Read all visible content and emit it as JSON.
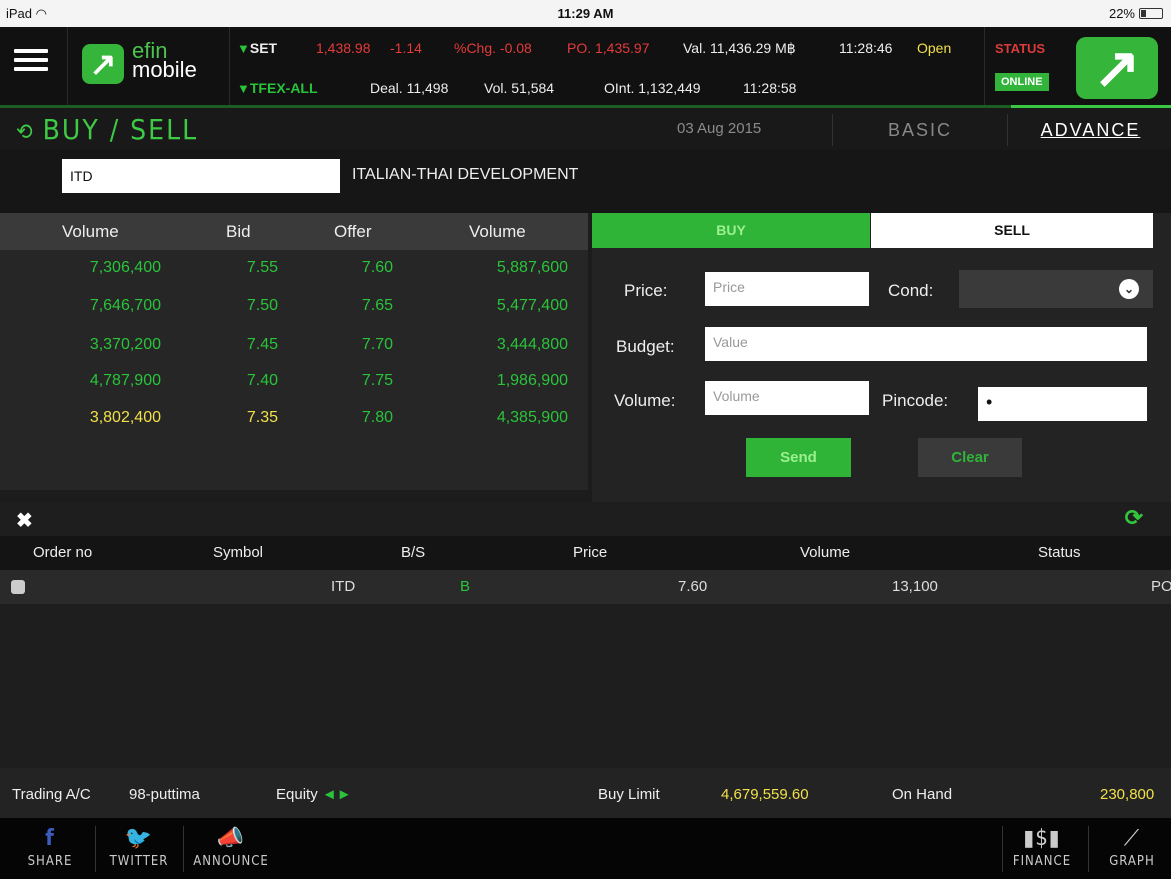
{
  "status_bar": {
    "device": "iPad",
    "time": "11:29 AM",
    "battery": "22%"
  },
  "header": {
    "logo_text_top": "efin",
    "logo_text_bottom": "mobile",
    "set": {
      "label": "SET",
      "index": "1,438.98",
      "change": "-1.14",
      "pct_change": "%Chg. -0.08",
      "po": "PO. 1,435.97",
      "value": "Val. 11,436.29 M฿",
      "time": "11:28:46",
      "state": "Open"
    },
    "tfex": {
      "label": "TFEX-ALL",
      "deal": "Deal. 11,498",
      "volume": "Vol. 51,584",
      "oint": "OInt. 1,132,449",
      "time": "11:28:58"
    },
    "status_label": "STATUS",
    "status_value": "ONLINE"
  },
  "subheader": {
    "title": "BUY / SELL",
    "date": "03 Aug 2015",
    "tab_basic": "BASIC",
    "tab_advance": "ADVANCE"
  },
  "symbol": {
    "code": "ITD",
    "name": "ITALIAN-THAI DEVELOPMENT"
  },
  "bid_offer": {
    "headers": [
      "Volume",
      "Bid",
      "Offer",
      "Volume"
    ],
    "rows": [
      {
        "bid_vol": "7,306,400",
        "bid": "7.55",
        "offer": "7.60",
        "offer_vol": "5,887,600"
      },
      {
        "bid_vol": "7,646,700",
        "bid": "7.50",
        "offer": "7.65",
        "offer_vol": "5,477,400"
      },
      {
        "bid_vol": "3,370,200",
        "bid": "7.45",
        "offer": "7.70",
        "offer_vol": "3,444,800"
      },
      {
        "bid_vol": "4,787,900",
        "bid": "7.40",
        "offer": "7.75",
        "offer_vol": "1,986,900"
      },
      {
        "bid_vol": "3,802,400",
        "bid": "7.35",
        "offer": "7.80",
        "offer_vol": "4,385,900"
      }
    ]
  },
  "order_form": {
    "tab_buy": "BUY",
    "tab_sell": "SELL",
    "price_label": "Price:",
    "price_placeholder": "Price",
    "cond_label": "Cond:",
    "budget_label": "Budget:",
    "budget_placeholder": "Value",
    "volume_label": "Volume:",
    "volume_placeholder": "Volume",
    "pincode_label": "Pincode:",
    "pincode_value": "•",
    "send": "Send",
    "clear": "Clear"
  },
  "orders": {
    "headers": [
      "Order no",
      "Symbol",
      "B/S",
      "Price",
      "Volume",
      "Status"
    ],
    "rows": [
      {
        "order_no": "",
        "symbol": "ITD",
        "side": "B",
        "price": "7.60",
        "volume": "13,100",
        "status": "PO"
      }
    ]
  },
  "info_bar": {
    "account_label": "Trading A/C",
    "account": "98-puttima",
    "type": "Equity",
    "buy_limit_label": "Buy Limit",
    "buy_limit": "4,679,559.60",
    "on_hand_label": "On Hand",
    "on_hand": "230,800"
  },
  "bottom_nav": {
    "share": "SHARE",
    "twitter": "TWITTER",
    "announce": "ANNOUNCE",
    "finance": "FINANCE",
    "graph": "GRAPH"
  },
  "colors": {
    "accent_green": "#2fb438",
    "down_red": "#e43a3a",
    "bg": "#1c1c1c"
  }
}
